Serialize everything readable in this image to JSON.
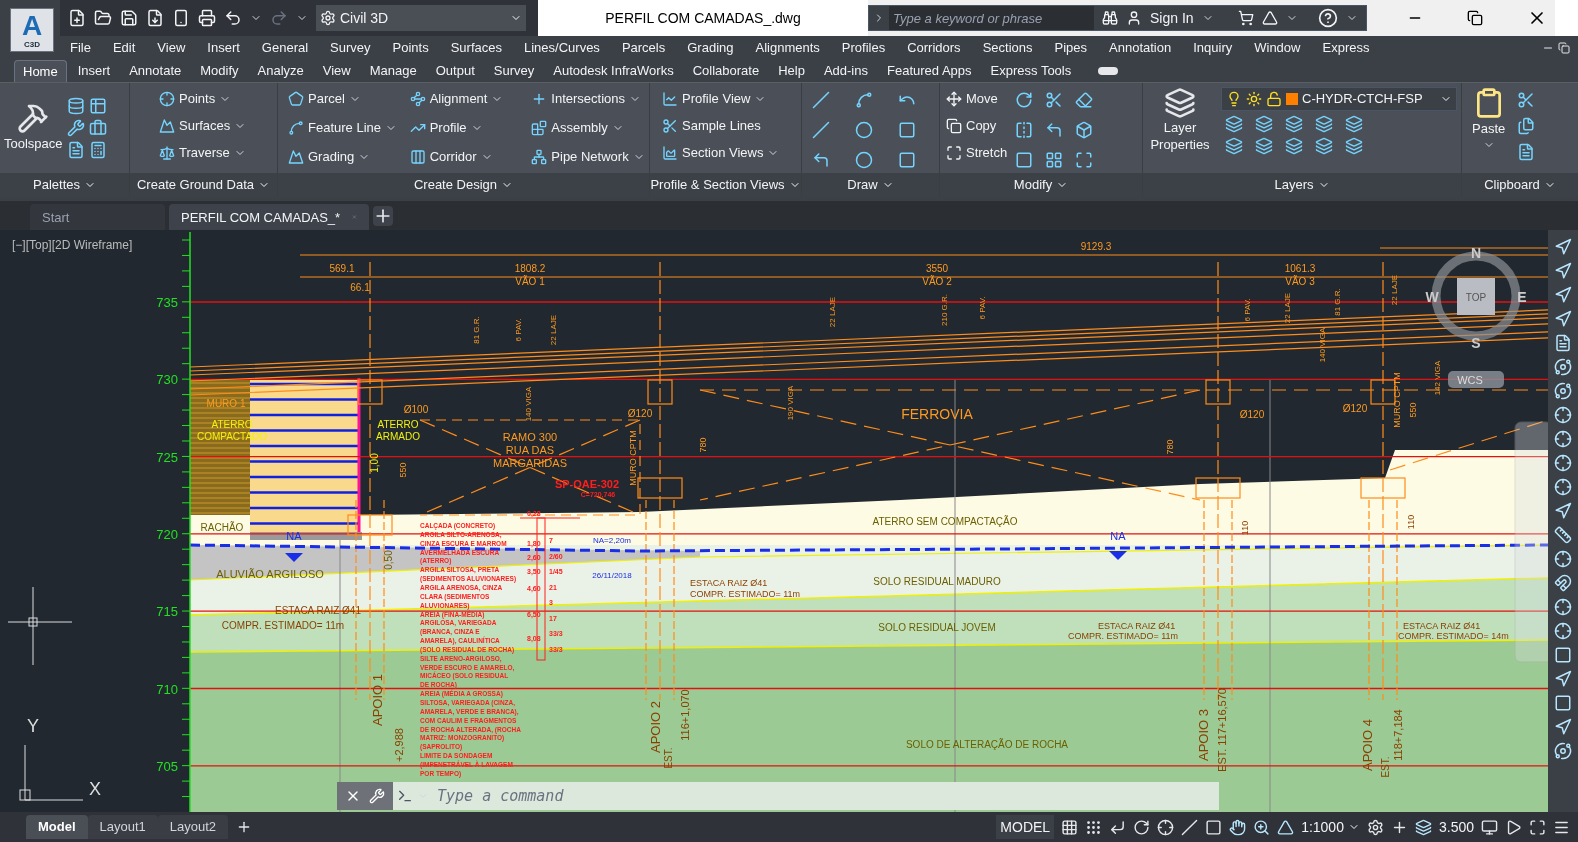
{
  "app": {
    "logo_letter": "A",
    "logo_badge": "C3D"
  },
  "workspace": "Civil 3D",
  "window": {
    "title": "PERFIL COM CAMADAS_.dwg"
  },
  "search": {
    "placeholder": "Type a keyword or phrase"
  },
  "sign_in": "Sign In",
  "menu": [
    "File",
    "Edit",
    "View",
    "Insert",
    "General",
    "Survey",
    "Points",
    "Surfaces",
    "Lines/Curves",
    "Parcels",
    "Grading",
    "Alignments",
    "Profiles",
    "Corridors",
    "Sections",
    "Pipes",
    "Annotation",
    "Inquiry",
    "Window",
    "Express"
  ],
  "ribbon_tabs": [
    {
      "label": "Home",
      "selected": true
    },
    {
      "label": "Insert",
      "selected": false
    },
    {
      "label": "Annotate",
      "selected": false
    },
    {
      "label": "Modify",
      "selected": false
    },
    {
      "label": "Analyze",
      "selected": false
    },
    {
      "label": "View",
      "selected": false
    },
    {
      "label": "Manage",
      "selected": false
    },
    {
      "label": "Output",
      "selected": false
    },
    {
      "label": "Survey",
      "selected": false
    },
    {
      "label": "Autodesk InfraWorks",
      "selected": false
    },
    {
      "label": "Collaborate",
      "selected": false
    },
    {
      "label": "Help",
      "selected": false
    },
    {
      "label": "Add-ins",
      "selected": false
    },
    {
      "label": "Featured Apps",
      "selected": false
    },
    {
      "label": "Express Tools",
      "selected": false
    }
  ],
  "ribbon": {
    "toolspace": "Toolspace",
    "panel_titles": [
      "Palettes",
      "Create Ground Data",
      "Create Design",
      "Profile & Section Views",
      "Draw",
      "Modify",
      "Layers",
      "Clipboard"
    ],
    "ground_data": [
      {
        "label": "Points",
        "dropdown": true
      },
      {
        "label": "Surfaces",
        "dropdown": true
      },
      {
        "label": "Traverse",
        "dropdown": true
      }
    ],
    "design": [
      {
        "label": "Parcel",
        "dropdown": true
      },
      {
        "label": "Feature Line",
        "dropdown": true
      },
      {
        "label": "Grading",
        "dropdown": true
      },
      {
        "label": "Alignment",
        "dropdown": true
      },
      {
        "label": "Profile",
        "dropdown": true
      },
      {
        "label": "Corridor",
        "dropdown": true
      },
      {
        "label": "Intersections",
        "dropdown": true
      },
      {
        "label": "Assembly",
        "dropdown": true
      },
      {
        "label": "Pipe Network",
        "dropdown": true
      }
    ],
    "views": [
      {
        "label": "Profile View",
        "dropdown": true
      },
      {
        "label": "Sample Lines",
        "dropdown": false
      },
      {
        "label": "Section Views",
        "dropdown": true
      }
    ],
    "modify": [
      "Move",
      "Copy",
      "Stretch"
    ],
    "layer_properties": "Layer Properties",
    "current_layer": {
      "name": "C-HYDR-CTCH-FSP",
      "color": "#ff7f00"
    },
    "paste": "Paste"
  },
  "file_tabs": [
    {
      "label": "Start",
      "selected": false
    },
    {
      "label": "PERFIL COM CAMADAS_*",
      "selected": true
    }
  ],
  "viewport": {
    "label": "[−][Top][2D Wireframe]"
  },
  "drawing": {
    "elevations": [
      "735",
      "730",
      "725",
      "720",
      "715",
      "710",
      "705"
    ],
    "texts": [
      {
        "kind": "dimension",
        "text": "569.1"
      },
      {
        "kind": "dimension",
        "text": "66.1"
      },
      {
        "kind": "dimension",
        "text": "1808.2"
      },
      {
        "kind": "dimension",
        "text": "VÃO 1"
      },
      {
        "kind": "dimension",
        "text": "3550"
      },
      {
        "kind": "dimension",
        "text": "VÃO 2"
      },
      {
        "kind": "dimension",
        "text": "9129.3"
      },
      {
        "kind": "dimension",
        "text": "1061.3"
      },
      {
        "kind": "dimension",
        "text": "VÃO 3"
      },
      {
        "kind": "dimension",
        "text": "Ø100"
      },
      {
        "kind": "dimension",
        "text": "Ø120"
      },
      {
        "kind": "dimension",
        "text": "Ø120"
      },
      {
        "kind": "dimension",
        "text": "Ø120"
      },
      {
        "kind": "dimension",
        "text": "FERROVIA"
      },
      {
        "kind": "dimension",
        "text": "RAMO 300"
      },
      {
        "kind": "dimension",
        "text": "RUA DAS"
      },
      {
        "kind": "dimension",
        "text": "MARGARIDAS"
      },
      {
        "kind": "dimension",
        "text": "MURO 1"
      },
      {
        "kind": "soil",
        "text": "ATERRO"
      },
      {
        "kind": "soil",
        "text": "COMPACTADO"
      },
      {
        "kind": "soil",
        "text": "ATERRO"
      },
      {
        "kind": "soil",
        "text": "ARMADO"
      },
      {
        "kind": "boring",
        "text": "SP-OAE-302"
      },
      {
        "kind": "boring",
        "text": "C=720,746"
      },
      {
        "kind": "soil",
        "text": "RACHÃO"
      },
      {
        "kind": "water",
        "text": "NA"
      },
      {
        "kind": "soil",
        "text": "ALUVIÃO ARGILOSO"
      },
      {
        "kind": "water",
        "text": "NA=2,20m"
      },
      {
        "kind": "water",
        "text": "26/11/2018"
      },
      {
        "kind": "soil",
        "text": "ATERRO SEM COMPACTAÇÃO"
      },
      {
        "kind": "soil",
        "text": "SOLO RESIDUAL MADURO"
      },
      {
        "kind": "soil",
        "text": "SOLO RESIDUAL JOVEM"
      },
      {
        "kind": "soil",
        "text": "SOLO DE ALTERAÇÃO DE ROCHA"
      },
      {
        "kind": "dimension",
        "text": "ESTACA RAIZ Ø41"
      },
      {
        "kind": "dimension",
        "text": "COMPR. ESTIMADO= 11m"
      },
      {
        "kind": "dimension",
        "text": "ESTACA RAIZ Ø41"
      },
      {
        "kind": "dimension",
        "text": "COMPR. ESTIMADO= 11m"
      },
      {
        "kind": "dimension",
        "text": "ESTACA RAIZ Ø41"
      },
      {
        "kind": "dimension",
        "text": "COMPR. ESTIMADO= 11m"
      },
      {
        "kind": "dimension",
        "text": "ESTACA RAIZ Ø41"
      },
      {
        "kind": "dimension",
        "text": "COMPR. ESTIMADO= 14m"
      },
      {
        "kind": "water",
        "text": "NA"
      }
    ],
    "vertical_texts": [
      {
        "kind": "dimension",
        "text": "APOIO 1"
      },
      {
        "kind": "dimension",
        "text": "+2,988"
      },
      {
        "kind": "dimension",
        "text": "APOIO 2"
      },
      {
        "kind": "dimension",
        "text": "EST."
      },
      {
        "kind": "dimension",
        "text": "116+1,070"
      },
      {
        "kind": "dimension",
        "text": "APOIO 3"
      },
      {
        "kind": "dimension",
        "text": "EST. 117+16,570"
      },
      {
        "kind": "dimension",
        "text": "APOIO 4"
      },
      {
        "kind": "dimension",
        "text": "EST."
      },
      {
        "kind": "dimension",
        "text": "118+7,184"
      },
      {
        "kind": "soil",
        "text": "1,00"
      },
      {
        "kind": "soil",
        "text": "0,50"
      },
      {
        "kind": "dimension",
        "text": "550"
      },
      {
        "kind": "dimension",
        "text": "780"
      },
      {
        "kind": "dimension",
        "text": "780"
      },
      {
        "kind": "dimension",
        "text": "550"
      },
      {
        "kind": "dimension",
        "text": "110"
      },
      {
        "kind": "dimension",
        "text": "110"
      },
      {
        "kind": "dimension",
        "text": "MURO CPTM"
      },
      {
        "kind": "dimension",
        "text": "MURO CPTM"
      },
      {
        "kind": "dimension",
        "text": "81 G.R."
      },
      {
        "kind": "dimension",
        "text": "6 PAV."
      },
      {
        "kind": "dimension",
        "text": "22 LAJE"
      },
      {
        "kind": "dimension",
        "text": "140 VIGA"
      },
      {
        "kind": "dimension",
        "text": "22 LAJE"
      },
      {
        "kind": "dimension",
        "text": "210 G.R."
      },
      {
        "kind": "dimension",
        "text": "6 PAV."
      },
      {
        "kind": "dimension",
        "text": "190 VIGA"
      },
      {
        "kind": "dimension",
        "text": "6 PAV."
      },
      {
        "kind": "dimension",
        "text": "22 LAJE"
      },
      {
        "kind": "dimension",
        "text": "81 G.R."
      },
      {
        "kind": "dimension",
        "text": "140 VIGA"
      },
      {
        "kind": "dimension",
        "text": "22 LAJE"
      },
      {
        "kind": "dimension",
        "text": "142 VIGA"
      }
    ],
    "boring_log": {
      "lines": [
        "CALÇADA (CONCRETO)",
        "ARGILA SILTO-ARENOSA,",
        "CINZA ESCURA E MARROM",
        "AVERMELHADA ESCURA",
        "(ATERRO)",
        "ARGILA SILTOSA, PRETA",
        "(SEDIMENTOS ALUVIONARES)",
        "ARGILA ARENOSA, CINZA",
        "CLARA (SEDIMENTOS",
        "ALUVIONARES)",
        "AREIA (FINA-MÉDIA)",
        "ARGILOSA, VARIEGADA",
        "(BRANCA, CINZA E",
        "AMARELA), CAULINÍTICA",
        "(SOLO RESIDUAL DE ROCHA)",
        "SILTE ARENO-ARGILOSO,",
        "VERDE ESCURO E AMARELO,",
        "MICÁCEO (SOLO RESIDUAL",
        "DE ROCHA)",
        "AREIA (MÉDIA A GROSSA)",
        "SILTOSA, VARIEGADA (CINZA,",
        "AMARELA, VERDE E BRANCA),",
        "COM CAULIM E FRAGMENTOS",
        "DE ROCHA ALTERADA, (ROCHA",
        "MATRIZ: MONZOGRANITO)",
        "(SAPROLITO)",
        "LIMITE DA SONDAGEM",
        "(IMPENETRÁVEL À LAVAGEM",
        "POR TEMPO)"
      ],
      "depths": [
        "0,28",
        "1,80",
        "2,60",
        "3,50",
        "4,60",
        "6,50",
        "8,08"
      ],
      "spt": [
        "7",
        "2/60",
        "1/45",
        "21",
        "3",
        "17",
        "33/3",
        "33/3"
      ]
    }
  },
  "viewcube": {
    "north": "N",
    "west": "W",
    "east": "E",
    "south": "S",
    "face": "TOP",
    "ucs": "WCS"
  },
  "ucs_icon": {
    "y": "Y",
    "x": "X"
  },
  "command_line": {
    "placeholder": "Type a command"
  },
  "layout_tabs": [
    {
      "label": "Model",
      "selected": true
    },
    {
      "label": "Layout1",
      "selected": false
    },
    {
      "label": "Layout2",
      "selected": false
    }
  ],
  "status_bar": {
    "mode": "MODEL",
    "scale": "1:1000",
    "annotation_scale": "3.500"
  }
}
